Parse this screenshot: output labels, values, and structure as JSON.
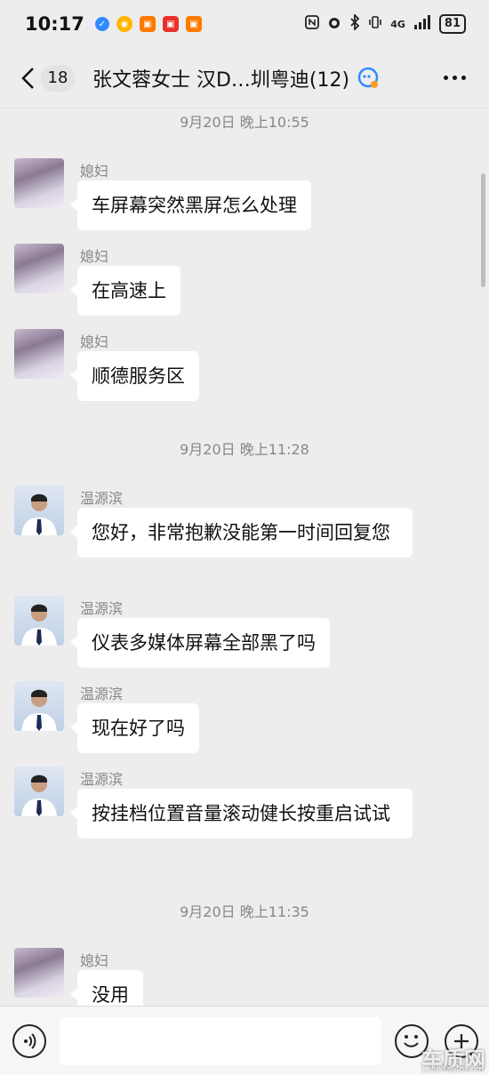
{
  "status_bar": {
    "time": "10:17",
    "network": "4G",
    "battery": "81"
  },
  "header": {
    "unread_count": "18",
    "title": "张文蓉女士 汉D…圳粤迪(12)"
  },
  "timestamps": [
    "9月20日 晚上10:55",
    "9月20日 晚上11:28",
    "9月20日 晚上11:35"
  ],
  "messages": [
    {
      "sender": "媳妇",
      "text": "车屏幕突然黑屏怎么处理"
    },
    {
      "sender": "媳妇",
      "text": "在高速上"
    },
    {
      "sender": "媳妇",
      "text": "顺德服务区"
    },
    {
      "sender": "温源滨",
      "text": "您好，非常抱歉没能第一时间回复您"
    },
    {
      "sender": "温源滨",
      "text": "仪表多媒体屏幕全部黑了吗"
    },
    {
      "sender": "温源滨",
      "text": "现在好了吗"
    },
    {
      "sender": "温源滨",
      "text": "按挂档位置音量滚动健长按重启试试"
    },
    {
      "sender": "媳妇",
      "text": "没用"
    }
  ],
  "input_bar": {
    "value": "",
    "placeholder": ""
  },
  "watermark": {
    "text": "车质网",
    "sub": "12365auto.com"
  },
  "colors": {
    "background": "#ededed",
    "bubble": "#ffffff",
    "header_text": "#111111",
    "meta_text": "#888888"
  }
}
